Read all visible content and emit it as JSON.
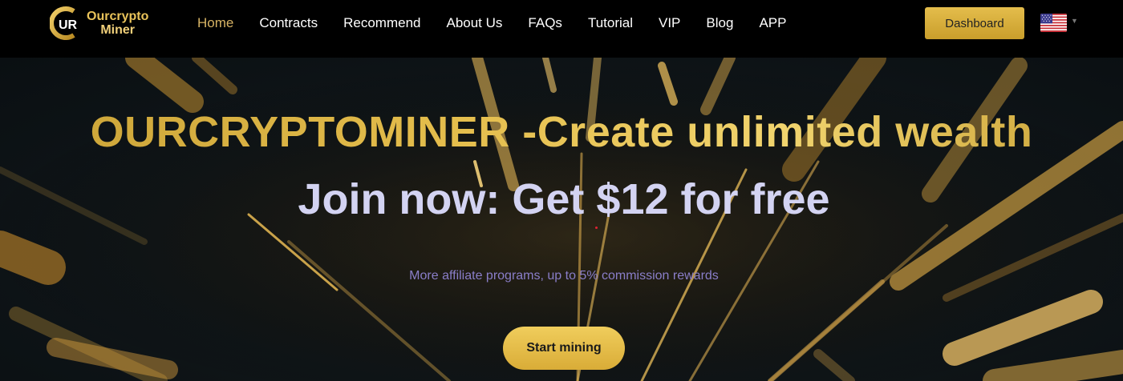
{
  "brand": {
    "line1": "Ourcrypto",
    "line2": "Miner",
    "mark_text": "UR",
    "primary_color": "#e4bd4c"
  },
  "nav": {
    "items": [
      {
        "label": "Home",
        "active": true
      },
      {
        "label": "Contracts",
        "active": false
      },
      {
        "label": "Recommend",
        "active": false
      },
      {
        "label": "About Us",
        "active": false
      },
      {
        "label": "FAQs",
        "active": false
      },
      {
        "label": "Tutorial",
        "active": false
      },
      {
        "label": "VIP",
        "active": false
      },
      {
        "label": "Blog",
        "active": false
      },
      {
        "label": "APP",
        "active": false
      }
    ],
    "dashboard_label": "Dashboard",
    "language_icon": "us-flag-icon"
  },
  "hero": {
    "headline": "OURCRYPTOMINER -Create unlimited wealth",
    "subheadline": "Join now: Get $12 for free",
    "tagline": "More affiliate programs, up to 5% commission rewards",
    "cta_label": "Start mining"
  }
}
